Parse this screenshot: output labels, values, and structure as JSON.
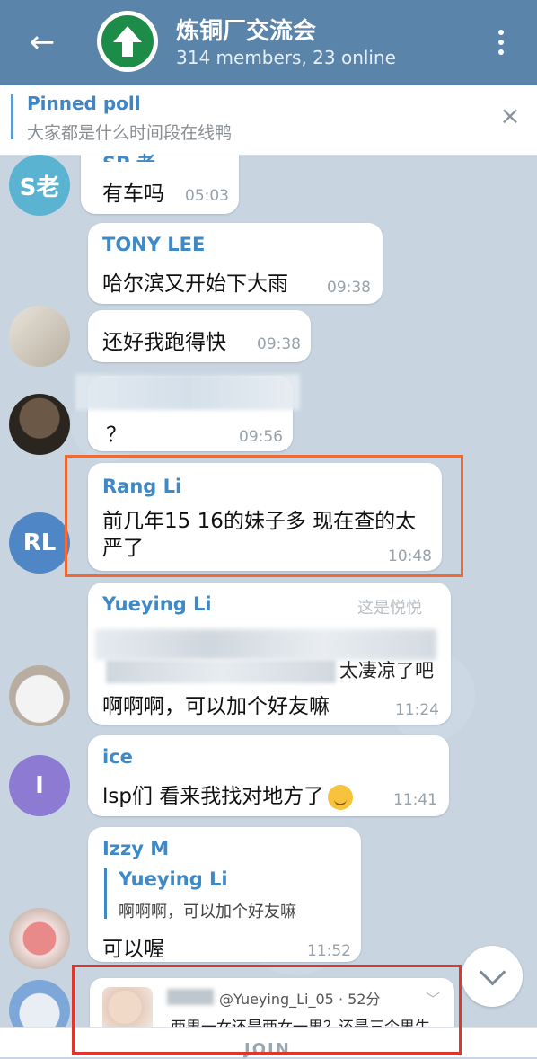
{
  "header": {
    "back_icon": "arrow-left-icon",
    "title": "炼铜厂交流会",
    "subtitle": "314 members, 23 online",
    "menu_icon": "more-vertical-icon"
  },
  "pinned": {
    "label": "Pinned poll",
    "text": "大家都是什么时间段在线鸭",
    "close": "×"
  },
  "avatars": {
    "s": "S老",
    "rl": "RL",
    "i": "I"
  },
  "messages": [
    {
      "sender_partial": "SP 老",
      "text": "有车吗",
      "time": "05:03"
    },
    {
      "sender": "TONY LEE",
      "text": "哈尔滨又开始下大雨",
      "time": "09:38"
    },
    {
      "text": "还好我跑得快",
      "time": "09:38"
    },
    {
      "text": "？",
      "time": "09:56"
    },
    {
      "sender": "Rang Li",
      "text": "前几年15 16的妹子多 现在查的太严了",
      "time": "10:48"
    },
    {
      "sender": "Yueying Li",
      "note": "这是悦悦",
      "quote_tail": "太凄凉了吧",
      "text": "啊啊啊，可以加个好友嘛",
      "time": "11:24"
    },
    {
      "sender": "ice",
      "text": "lsp们 看来我找对地方了",
      "time": "11:41"
    },
    {
      "sender": "Izzy M",
      "reply_name": "Yueying Li",
      "reply_text": "啊啊啊，可以加个好友嘛",
      "text": "可以喔",
      "time": "11:52"
    }
  ],
  "preview": {
    "handle": "@Yueying_Li_05 · 52分",
    "text": "两男一女还是两女一男？还是三个男生"
  },
  "scroll_down_icon": "chevron-down-icon",
  "join": "JOIN",
  "colors": {
    "header": "#5b84ab",
    "accent": "#3f8ac6",
    "highlight_box": "#ef6a35"
  }
}
